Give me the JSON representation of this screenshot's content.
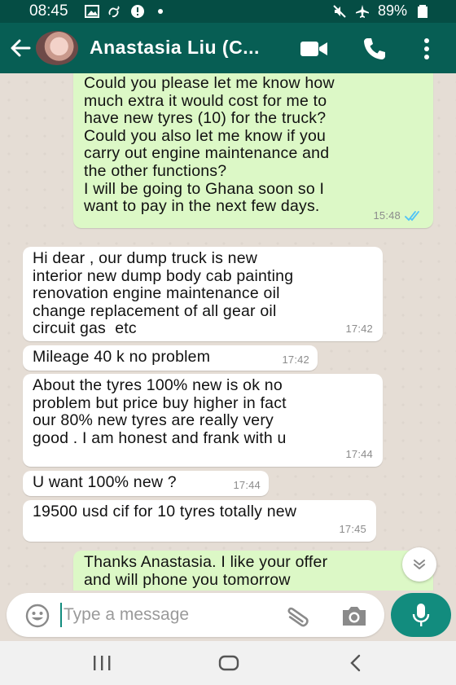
{
  "status_bar": {
    "time": "08:45",
    "battery": "89%",
    "icons_left": [
      "image-icon",
      "link-icon",
      "alert-icon",
      "dot-icon"
    ],
    "icons_right": [
      "mute-icon",
      "airplane-icon",
      "battery-icon"
    ]
  },
  "header": {
    "contact_name": "Anastasia Liu (C...",
    "icons": [
      "back-arrow-icon",
      "avatar",
      "video-call-icon",
      "phone-icon",
      "more-vert-icon"
    ]
  },
  "messages": [
    {
      "direction": "out",
      "text": "Could you please let me know how\nmuch extra it would cost for me to\nhave new tyres (10) for the truck?\nCould you also let me know if you\ncarry out engine maintenance and\nthe other functions?\nI will be going to Ghana soon so I\nwant to pay in the next few days.",
      "time": "15:48",
      "read": true
    },
    {
      "direction": "in",
      "text": "Hi dear , our dump truck is new\ninterior new dump body cab painting\nrenovation engine maintenance oil\nchange replacement of all gear oil\ncircuit gas  etc",
      "time": "17:42"
    },
    {
      "direction": "in",
      "text": "Mileage 40 k no problem",
      "time": "17:42"
    },
    {
      "direction": "in",
      "text": "About the tyres 100% new is ok no\nproblem but price buy higher in fact\nour 80% new tyres are really very\ngood . I am honest and frank with u",
      "time": "17:44"
    },
    {
      "direction": "in",
      "text": "U want 100% new ?",
      "time": "17:44"
    },
    {
      "direction": "in",
      "text": "19500 usd cif for 10 tyres totally new",
      "time": "17:45"
    },
    {
      "direction": "out",
      "text": "Thanks Anastasia. I like your offer\nand will phone you tomorrow",
      "time": ""
    }
  ],
  "input": {
    "placeholder": "Type a message",
    "icons": [
      "emoji-icon",
      "attach-icon",
      "camera-icon",
      "mic-icon"
    ]
  },
  "scroll_down_icon": "chevron-double-down-icon",
  "nav": {
    "icons": [
      "recent-apps-icon",
      "home-icon",
      "back-icon"
    ]
  },
  "colors": {
    "header": "#075e54",
    "status_bar": "#054d44",
    "outgoing_bubble": "#dcf8c6",
    "incoming_bubble": "#ffffff",
    "accent": "#128c7e",
    "read_ticks": "#4fc3f7"
  }
}
